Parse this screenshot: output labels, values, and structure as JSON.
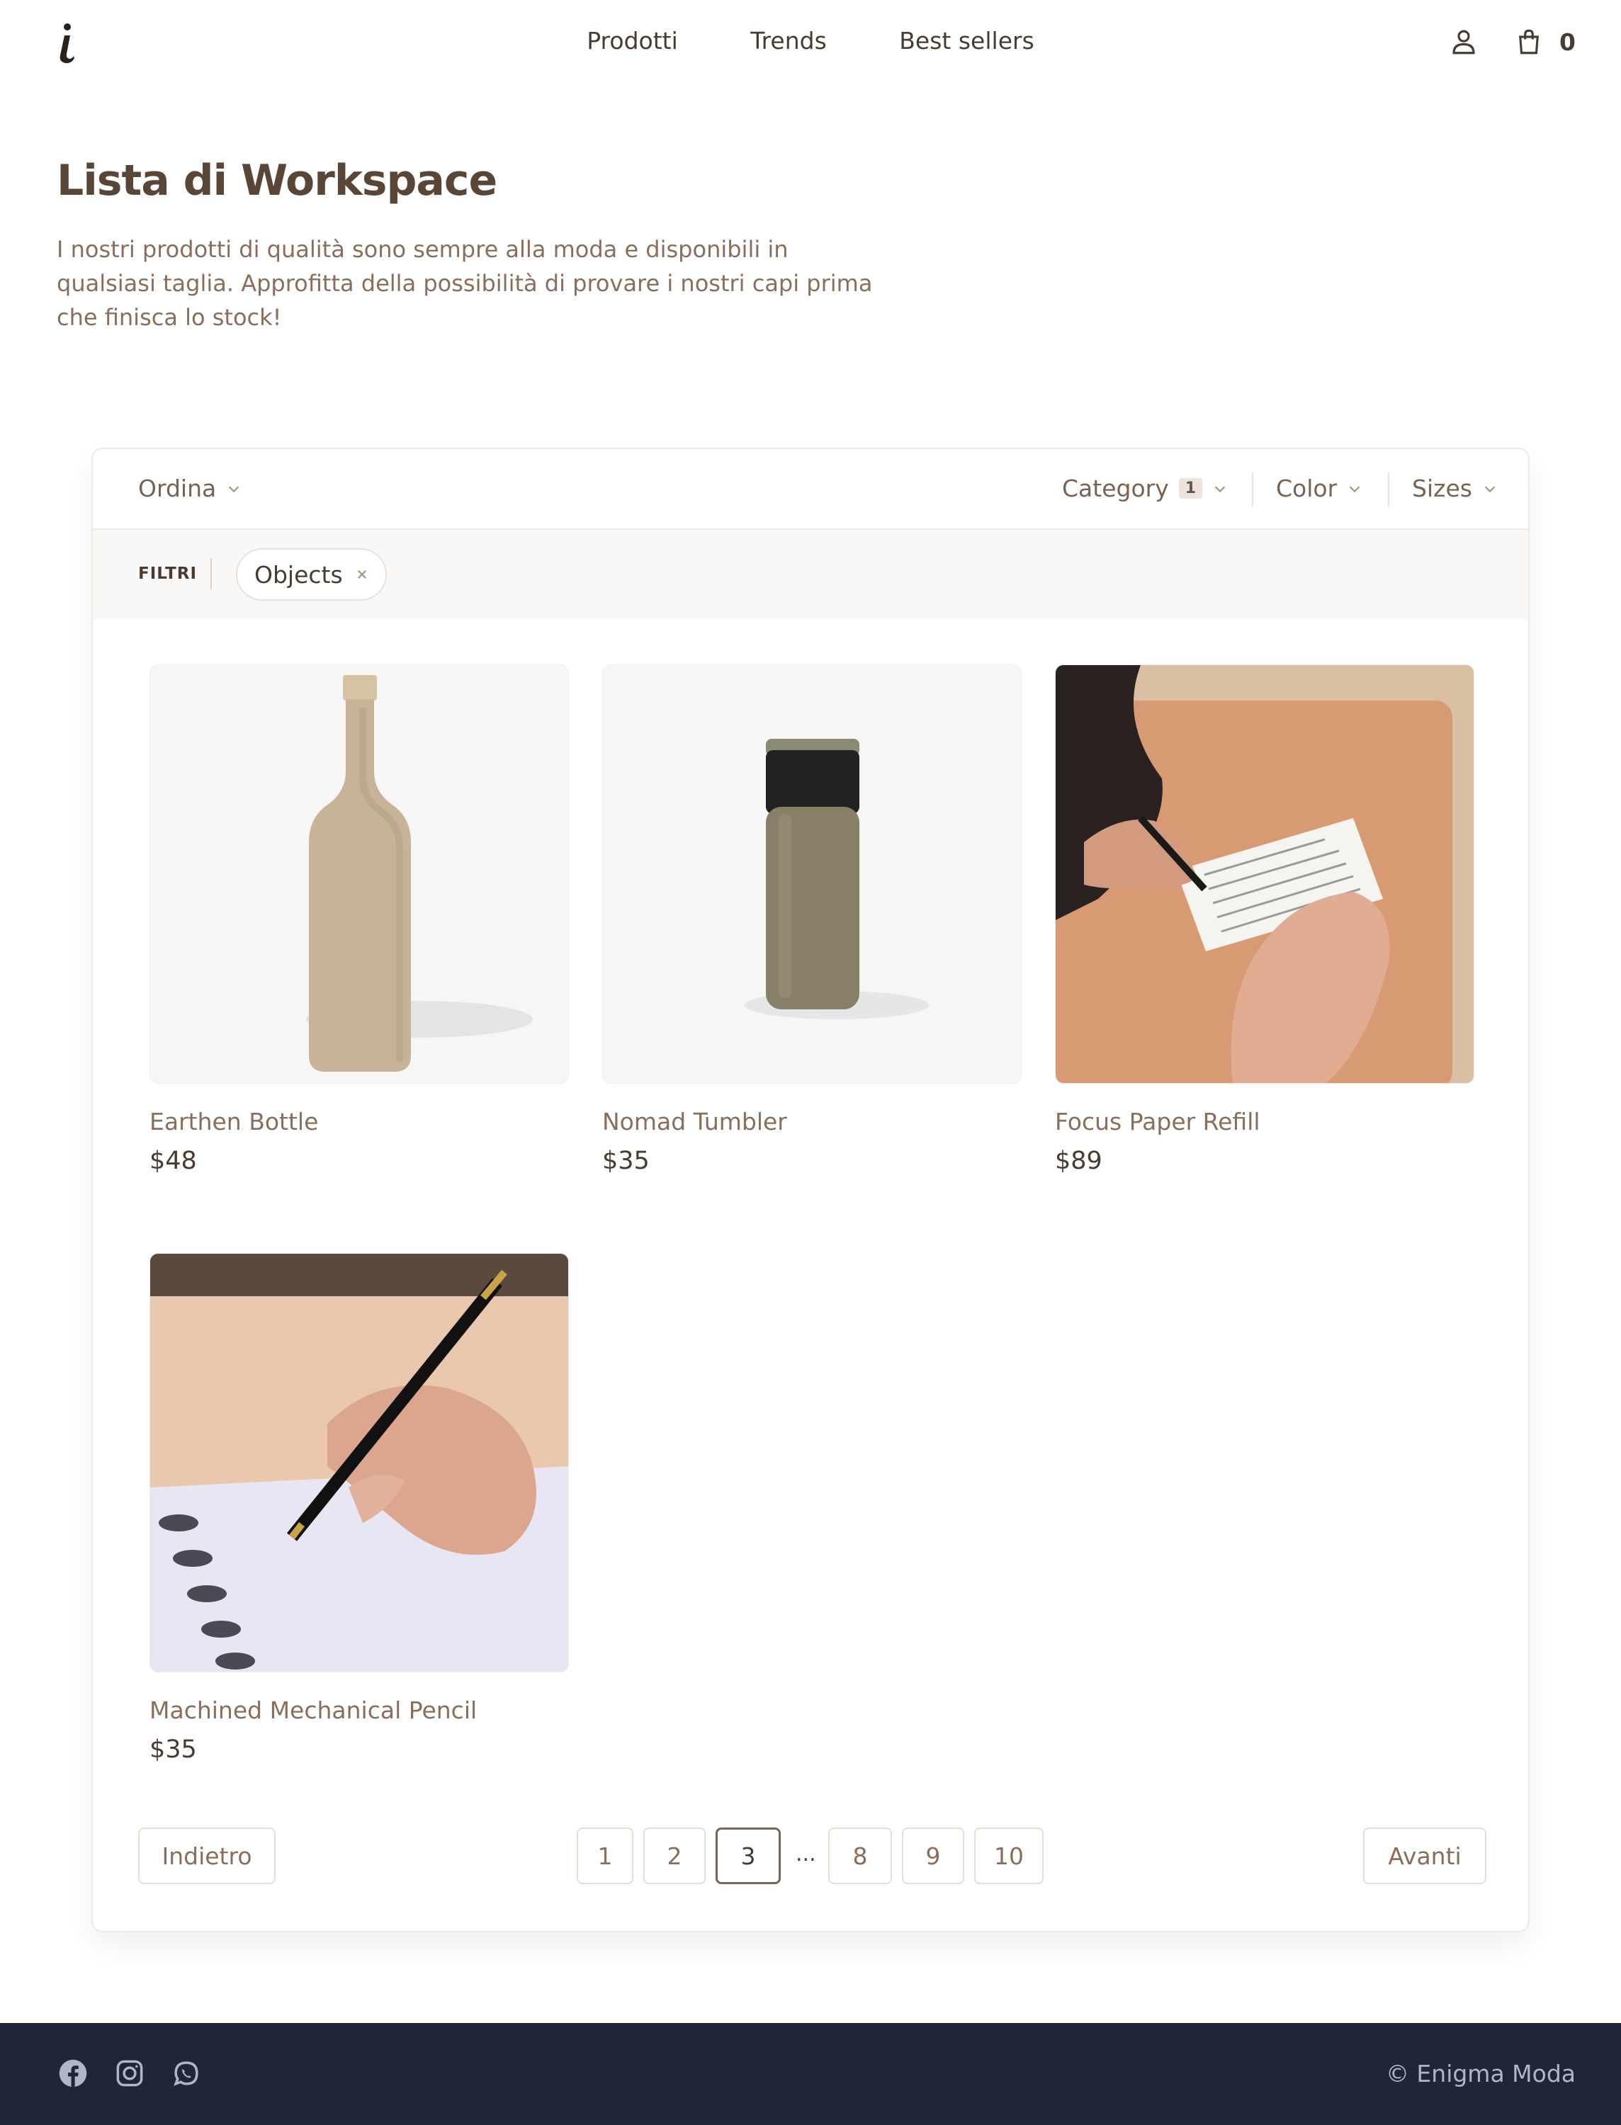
{
  "header": {
    "nav": [
      "Prodotti",
      "Trends",
      "Best sellers"
    ],
    "cart_count": "0"
  },
  "intro": {
    "title": "Lista di Workspace",
    "description": "I nostri prodotti di qualità sono sempre alla moda e disponibili in qualsiasi taglia. Approfitta della possibilità di provare i nostri capi prima che finisca lo stock!"
  },
  "toolbar": {
    "sort_label": "Ordina",
    "category_label": "Category",
    "category_count": "1",
    "color_label": "Color",
    "sizes_label": "Sizes"
  },
  "filters": {
    "label": "FILTRI",
    "active": [
      "Objects"
    ]
  },
  "products": [
    {
      "name": "Earthen Bottle",
      "price": "$48"
    },
    {
      "name": "Nomad Tumbler",
      "price": "$35"
    },
    {
      "name": "Focus Paper Refill",
      "price": "$89"
    },
    {
      "name": "Machined Mechanical Pencil",
      "price": "$35"
    }
  ],
  "pagination": {
    "prev": "Indietro",
    "next": "Avanti",
    "pages": [
      "1",
      "2",
      "3",
      "...",
      "8",
      "9",
      "10"
    ],
    "current": "3"
  },
  "footer": {
    "social_icons": [
      "facebook-icon",
      "instagram-icon",
      "whatsapp-icon"
    ],
    "copyright": "© Enigma Moda"
  },
  "colors": {
    "brand_brown": "#5a4637",
    "accent_brown": "#8a6d5c",
    "footer_bg": "#1e2638"
  }
}
